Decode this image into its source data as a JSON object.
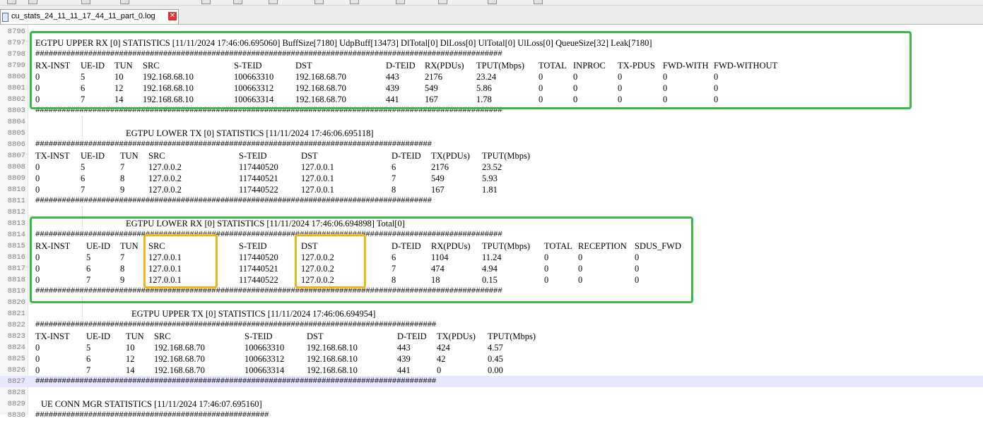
{
  "tab": {
    "label": "cu_stats_24_11_11_17_44_11_part_0.log"
  },
  "line_numbers": [
    "8796",
    "8797",
    "8798",
    "8799",
    "8800",
    "8801",
    "8802",
    "8803",
    "8804",
    "8805",
    "8806",
    "8807",
    "8808",
    "8809",
    "8810",
    "8811",
    "8812",
    "8813",
    "8814",
    "8815",
    "8816",
    "8817",
    "8818",
    "8819",
    "8820",
    "8821",
    "8822",
    "8823",
    "8824",
    "8825",
    "8826",
    "8827",
    "8828",
    "8829",
    "8830"
  ],
  "current_line": "8827",
  "sections": {
    "upper_rx": {
      "title": "EGTPU UPPER RX [0] STATISTICS [11/11/2024 17:46:06.695060] BuffSize[7180] UdpBuff[13473] DlTotal[0] DlLoss[0] UlTotal[0] UlLoss[0] QueueSize[32] Leak[7180]",
      "hash_line": "##########################################################################################################",
      "headers": [
        "RX-INST",
        "UE-ID",
        "TUN",
        "SRC",
        "S-TEID",
        "DST",
        "D-TEID",
        "RX(PDUs)",
        "TPUT(Mbps)",
        "TOTAL",
        "INPROC",
        "TX-PDUS",
        "FWD-WITH",
        "FWD-WITHOUT"
      ],
      "rows": [
        [
          "0",
          "5",
          "10",
          "192.168.68.10",
          "100663310",
          "192.168.68.70",
          "443",
          "2176",
          "23.24",
          "0",
          "0",
          "0",
          "0",
          "0"
        ],
        [
          "0",
          "6",
          "12",
          "192.168.68.10",
          "100663312",
          "192.168.68.70",
          "439",
          "549",
          "5.86",
          "0",
          "0",
          "0",
          "0",
          "0"
        ],
        [
          "0",
          "7",
          "14",
          "192.168.68.10",
          "100663314",
          "192.168.68.70",
          "441",
          "167",
          "1.78",
          "0",
          "0",
          "0",
          "0",
          "0"
        ]
      ],
      "end_hash_line": "##########################################################################################################"
    },
    "lower_tx": {
      "title": "EGTPU LOWER TX [0] STATISTICS [11/11/2024 17:46:06.695118]",
      "hash_line": "##########################################################################################",
      "headers": [
        "TX-INST",
        "UE-ID",
        "TUN",
        "SRC",
        "S-TEID",
        "DST",
        "D-TEID",
        "TX(PDUs)",
        "TPUT(Mbps)"
      ],
      "rows": [
        [
          "0",
          "5",
          "7",
          "127.0.0.2",
          "117440520",
          "127.0.0.1",
          "6",
          "2176",
          "23.52"
        ],
        [
          "0",
          "6",
          "8",
          "127.0.0.2",
          "117440521",
          "127.0.0.1",
          "7",
          "549",
          "5.93"
        ],
        [
          "0",
          "7",
          "9",
          "127.0.0.2",
          "117440522",
          "127.0.0.1",
          "8",
          "167",
          "1.81"
        ]
      ],
      "end_hash_line": "##########################################################################################"
    },
    "lower_rx": {
      "title": "EGTPU LOWER RX [0] STATISTICS [11/11/2024 17:46:06.694898] Total[0]",
      "hash_line": "##########################################################################################################",
      "headers": [
        "RX-INST",
        "UE-ID",
        "TUN",
        "SRC",
        "S-TEID",
        "DST",
        "D-TEID",
        "RX(PDUs)",
        "TPUT(Mbps)",
        "TOTAL",
        "RECEPTION",
        "SDUS_FWD"
      ],
      "rows": [
        [
          "0",
          "5",
          "7",
          "127.0.0.1",
          "117440520",
          "127.0.0.2",
          "6",
          "1104",
          "11.24",
          "0",
          "0",
          "0"
        ],
        [
          "0",
          "6",
          "8",
          "127.0.0.1",
          "117440521",
          "127.0.0.2",
          "7",
          "474",
          "4.94",
          "0",
          "0",
          "0"
        ],
        [
          "0",
          "7",
          "9",
          "127.0.0.1",
          "117440522",
          "127.0.0.2",
          "8",
          "18",
          "0.15",
          "0",
          "0",
          "0"
        ]
      ],
      "end_hash_line": "##########################################################################################################"
    },
    "upper_tx": {
      "title": "EGTPU UPPER TX [0] STATISTICS [11/11/2024 17:46:06.694954]",
      "hash_line": "###########################################################################################",
      "headers": [
        "TX-INST",
        "UE-ID",
        "TUN",
        "SRC",
        "S-TEID",
        "DST",
        "D-TEID",
        "TX(PDUs)",
        "TPUT(Mbps)"
      ],
      "rows": [
        [
          "0",
          "5",
          "10",
          "192.168.68.70",
          "100663310",
          "192.168.68.10",
          "443",
          "424",
          "4.57"
        ],
        [
          "0",
          "6",
          "12",
          "192.168.68.70",
          "100663312",
          "192.168.68.10",
          "439",
          "42",
          "0.45"
        ],
        [
          "0",
          "7",
          "14",
          "192.168.68.70",
          "100663314",
          "192.168.68.10",
          "441",
          "0",
          "0.00"
        ]
      ],
      "end_hash_line": "###########################################################################################"
    },
    "ue_conn": {
      "title": "UE CONN MGR STATISTICS [11/11/2024 17:46:07.695160]",
      "hash_line": "#####################################################"
    }
  },
  "highlight_colors": {
    "section_box": "#3cb84a",
    "ip_box": "#f2b515"
  }
}
